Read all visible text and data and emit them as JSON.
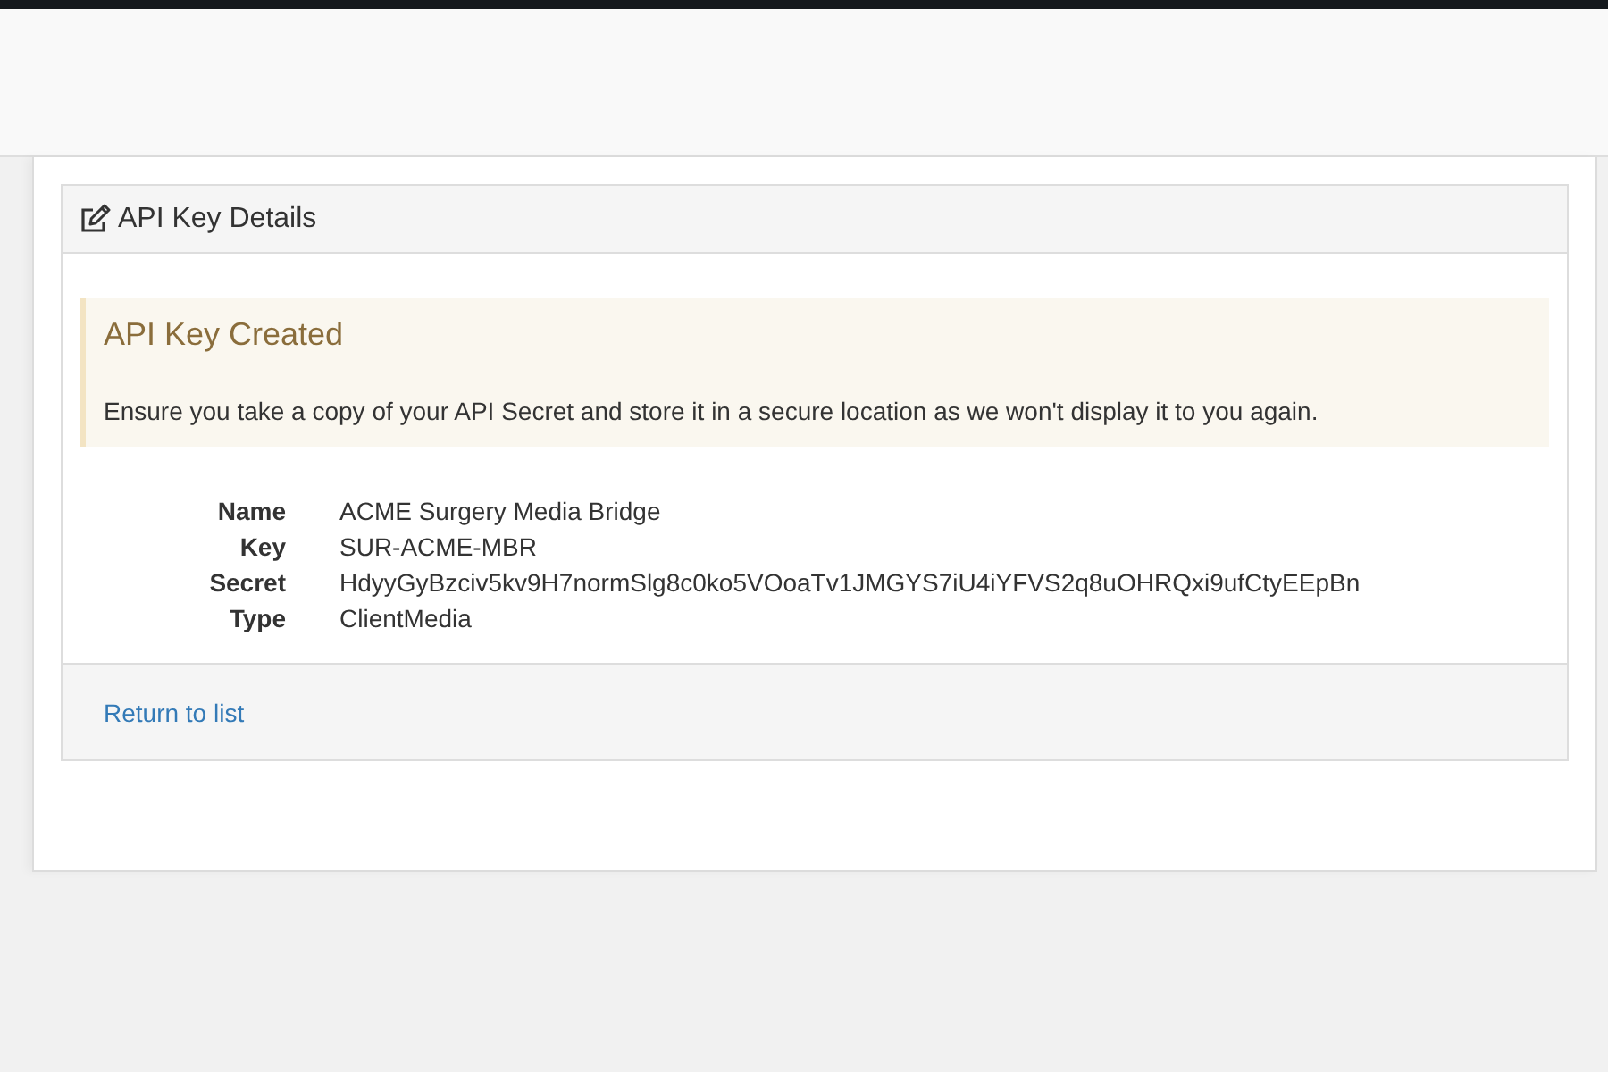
{
  "card": {
    "title": "API Key Details"
  },
  "alert": {
    "title": "API Key Created",
    "message": "Ensure you take a copy of your API Secret and store it in a secure location as we won't display it to you again."
  },
  "details": [
    {
      "label": "Name",
      "value": "ACME Surgery Media Bridge"
    },
    {
      "label": "Key",
      "value": "SUR-ACME-MBR"
    },
    {
      "label": "Secret",
      "value": "HdyyGyBzciv5kv9H7normSlg8c0ko5VOoaTv1JMGYS7iU4iYFVS2q8uOHRQxi9ufCtyEEpBn"
    },
    {
      "label": "Type",
      "value": "ClientMedia"
    }
  ],
  "footer": {
    "link": "Return to list"
  }
}
